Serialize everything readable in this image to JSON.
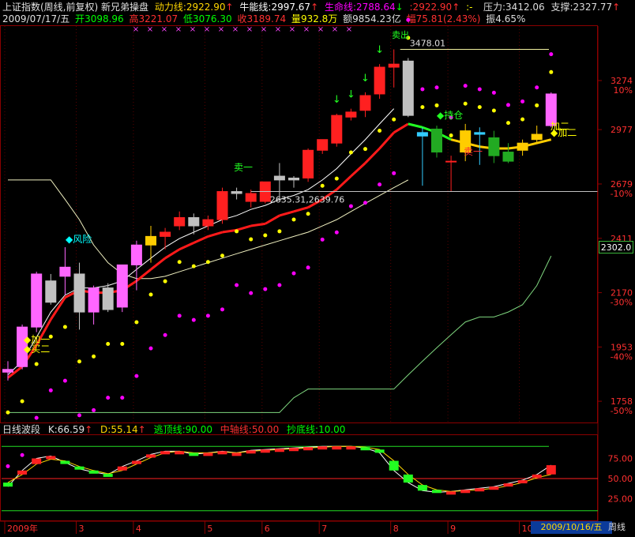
{
  "header": {
    "title": "上证指数(周线,前复权) 新兄弟操盘",
    "dongli_label": "动力线:",
    "dongli_value": "2922.90",
    "niuneng_label": "牛能线:",
    "niuneng_value": "2997.67",
    "shengming_label": "生命线:",
    "shengming_value": "2788.64",
    "extra_value": ":2922.90",
    "extra_tail": ":-",
    "pressure_label": "压力:",
    "pressure_value": "3412.06",
    "support_label": "支撑:",
    "support_value": "2327.77",
    "arrow_up": "↑",
    "arrow_down": "↓"
  },
  "quote": {
    "date": "2009/07/17/五",
    "open_label": "开",
    "open": "3098.96",
    "high_label": "高",
    "high": "3221.07",
    "low_label": "低",
    "low": "3076.30",
    "close_label": "收",
    "close": "3189.74",
    "vol_label": "量",
    "vol": "932.8万",
    "amount_label": "额",
    "amount": "9854.23亿",
    "range_label": "幅",
    "range": "75.81(2.43%)",
    "amp_label": "振",
    "amp": "4.65%"
  },
  "colors": {
    "up": "#ff2020",
    "down": "#00ff00",
    "axis": "#8b0000",
    "magenta": "#ff00ff",
    "yellow": "#ffff00",
    "cyan": "#00ffff"
  },
  "price_axis": {
    "levels": [
      {
        "price": "3274",
        "pct": "10%"
      },
      {
        "price": "2977",
        "pct": ""
      },
      {
        "price": "2679",
        "pct": "-10%"
      },
      {
        "price": "2411",
        "pct": "-20%"
      },
      {
        "price": "2170",
        "pct": "-30%"
      },
      {
        "price": "1953",
        "pct": "-40%"
      },
      {
        "price": "1758",
        "pct": "-50%"
      }
    ],
    "current": "2302.0"
  },
  "annotations": {
    "risk": "风险",
    "sell1": "卖一",
    "sell1_b": "卖一",
    "add1": "加一",
    "buy2": "买二",
    "add2": "加二",
    "add2_b": "加二",
    "hold": "持仓",
    "peak_top": "卖出",
    "high_price": "3478.01",
    "low_price": "2635.31",
    "low_price2": "2639.76"
  },
  "indicator": {
    "name": "日线波段",
    "k_label": "K:",
    "k": "66.59",
    "d_label": "D:",
    "d": "55.14",
    "escape_label": "逃顶线:",
    "escape": "90.00",
    "mid_label": "中轴线:",
    "mid": "50.00",
    "bottom_label": "抄底线:",
    "bottom": "10.00",
    "axis": [
      "75.00",
      "50.00",
      "25.00"
    ]
  },
  "timeline": {
    "labels": [
      "2009年",
      "3",
      "4",
      "5",
      "6",
      "7",
      "8",
      "9",
      "10"
    ],
    "date": "2009/10/16/五",
    "period": "周线"
  },
  "chart_data": {
    "type": "candlestick",
    "period": "weekly",
    "y_scale": "log",
    "ylim": [
      1700,
      3600
    ],
    "ohlc": [
      {
        "o": 1870,
        "h": 1900,
        "l": 1830,
        "c": 1860
      },
      {
        "o": 1880,
        "h": 2040,
        "l": 1870,
        "c": 2030
      },
      {
        "o": 2030,
        "h": 2260,
        "l": 2010,
        "c": 2250
      },
      {
        "o": 2130,
        "h": 2250,
        "l": 2120,
        "c": 2220
      },
      {
        "o": 2240,
        "h": 2370,
        "l": 2160,
        "c": 2280
      },
      {
        "o": 2250,
        "h": 2300,
        "l": 2020,
        "c": 2090
      },
      {
        "o": 2090,
        "h": 2200,
        "l": 2040,
        "c": 2190
      },
      {
        "o": 2190,
        "h": 2210,
        "l": 2090,
        "c": 2100
      },
      {
        "o": 2110,
        "h": 2290,
        "l": 2090,
        "c": 2290
      },
      {
        "o": 2290,
        "h": 2400,
        "l": 2180,
        "c": 2380
      },
      {
        "o": 2380,
        "h": 2470,
        "l": 2300,
        "c": 2420
      },
      {
        "o": 2420,
        "h": 2460,
        "l": 2360,
        "c": 2440
      },
      {
        "o": 2470,
        "h": 2540,
        "l": 2450,
        "c": 2510
      },
      {
        "o": 2510,
        "h": 2530,
        "l": 2430,
        "c": 2470
      },
      {
        "o": 2470,
        "h": 2520,
        "l": 2450,
        "c": 2500
      },
      {
        "o": 2500,
        "h": 2660,
        "l": 2480,
        "c": 2640
      },
      {
        "o": 2640,
        "h": 2660,
        "l": 2600,
        "c": 2630
      },
      {
        "o": 2630,
        "h": 2650,
        "l": 2560,
        "c": 2590
      },
      {
        "o": 2590,
        "h": 2690,
        "l": 2580,
        "c": 2690
      },
      {
        "o": 2700,
        "h": 2790,
        "l": 2600,
        "c": 2720
      },
      {
        "o": 2700,
        "h": 2720,
        "l": 2660,
        "c": 2710
      },
      {
        "o": 2710,
        "h": 2870,
        "l": 2690,
        "c": 2860
      },
      {
        "o": 2860,
        "h": 2920,
        "l": 2840,
        "c": 2920
      },
      {
        "o": 2900,
        "h": 3070,
        "l": 2880,
        "c": 3060
      },
      {
        "o": 3050,
        "h": 3100,
        "l": 3030,
        "c": 3080
      },
      {
        "o": 3090,
        "h": 3200,
        "l": 3050,
        "c": 3180
      },
      {
        "o": 3190,
        "h": 3380,
        "l": 3160,
        "c": 3360
      },
      {
        "o": 3360,
        "h": 3478,
        "l": 3230,
        "c": 3380
      },
      {
        "o": 3400,
        "h": 3420,
        "l": 3050,
        "c": 3060
      },
      {
        "o": 2960,
        "h": 2990,
        "l": 2670,
        "c": 2940
      },
      {
        "o": 2980,
        "h": 3000,
        "l": 2820,
        "c": 2850
      },
      {
        "o": 2800,
        "h": 2830,
        "l": 2640,
        "c": 2800
      },
      {
        "o": 2970,
        "h": 3010,
        "l": 2800,
        "c": 2850
      },
      {
        "o": 2960,
        "h": 2990,
        "l": 2780,
        "c": 2950
      },
      {
        "o": 2930,
        "h": 2970,
        "l": 2790,
        "c": 2830
      },
      {
        "o": 2850,
        "h": 2900,
        "l": 2790,
        "c": 2800
      },
      {
        "o": 2860,
        "h": 2920,
        "l": 2830,
        "c": 2900
      },
      {
        "o": 2920,
        "h": 3000,
        "l": 2900,
        "c": 2950
      },
      {
        "o": 3000,
        "h": 3200,
        "l": 2990,
        "c": 3190
      }
    ],
    "lines": {
      "dongli": [
        1840,
        1880,
        1960,
        2060,
        2150,
        2180,
        2170,
        2170,
        2180,
        2220,
        2270,
        2320,
        2360,
        2390,
        2420,
        2440,
        2450,
        2470,
        2480,
        2520,
        2540,
        2560,
        2600,
        2650,
        2720,
        2790,
        2870,
        2960,
        3010,
        2990,
        2960,
        2920,
        2900,
        2880,
        2870,
        2870,
        2880,
        2900,
        2920
      ],
      "niuneng": [
        1850,
        1900,
        1990,
        2090,
        2160,
        2190,
        2190,
        2200,
        2220,
        2270,
        2320,
        2370,
        2410,
        2440,
        2470,
        2500,
        2520,
        2550,
        2570,
        2600,
        2620,
        2650,
        2700,
        2760,
        2840,
        2920,
        3010,
        3100,
        3150,
        3100,
        3050,
        3000,
        2980,
        2960,
        2950,
        2940,
        2950,
        2970,
        3000
      ],
      "shengming": [
        2700,
        2700,
        2700,
        2700,
        2600,
        2500,
        2380,
        2300,
        2250,
        2230,
        2230,
        2240,
        2260,
        2280,
        2300,
        2320,
        2340,
        2360,
        2380,
        2400,
        2420,
        2440,
        2470,
        2500,
        2540,
        2580,
        2620,
        2660,
        2700,
        2740,
        2760,
        2770,
        2780,
        2780,
        2780,
        2780,
        2780,
        2785,
        2790
      ],
      "support": [
        1720,
        1720,
        1720,
        1720,
        1720,
        1720,
        1720,
        1720,
        1720,
        1720,
        1720,
        1720,
        1720,
        1720,
        1720,
        1720,
        1720,
        1720,
        1720,
        1720,
        1770,
        1800,
        1800,
        1800,
        1800,
        1800,
        1800,
        1800,
        1850,
        1900,
        1950,
        2000,
        2050,
        2070,
        2070,
        2090,
        2120,
        2200,
        2330
      ]
    },
    "kd": {
      "k": [
        40,
        60,
        75,
        78,
        70,
        62,
        58,
        55,
        65,
        72,
        80,
        84,
        84,
        80,
        82,
        84,
        82,
        85,
        86,
        87,
        88,
        89,
        90,
        90,
        90,
        88,
        82,
        60,
        45,
        35,
        33,
        34,
        36,
        38,
        40,
        44,
        48,
        55,
        66.59
      ],
      "d": [
        45,
        55,
        68,
        74,
        72,
        65,
        60,
        56,
        60,
        68,
        76,
        82,
        84,
        82,
        82,
        83,
        82,
        84,
        85,
        86,
        87,
        88,
        89,
        90,
        90,
        89,
        86,
        72,
        55,
        42,
        36,
        34,
        35,
        36,
        38,
        41,
        45,
        51,
        55.14
      ],
      "escape": 90,
      "mid": 50,
      "bottom": 10
    }
  }
}
